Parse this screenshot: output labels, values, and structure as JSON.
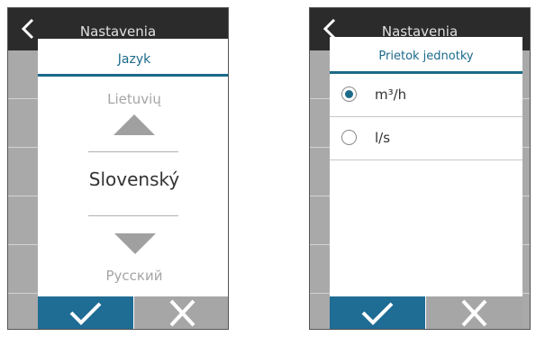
{
  "left_screen": {
    "header_title": "Nastavenia",
    "dialog": {
      "title": "Jazyk",
      "prev_language": "Lietuvių",
      "current_language": "Slovenský",
      "next_language": "Русский",
      "up_icon": "arrow-up-icon",
      "down_icon": "arrow-down-icon",
      "confirm_icon": "checkmark-icon",
      "cancel_icon": "close-icon"
    }
  },
  "right_screen": {
    "header_title": "Nastavenia",
    "dialog": {
      "title": "Prietok jednotky",
      "options": [
        {
          "label": "m³/h",
          "selected": true
        },
        {
          "label": "l/s",
          "selected": false
        }
      ],
      "confirm_icon": "checkmark-icon",
      "cancel_icon": "close-icon"
    }
  },
  "colors": {
    "accent": "#1c6a8a",
    "confirm_button": "#1f6c94",
    "cancel_button": "#a6a6a6",
    "header": "#2b2b2b",
    "background_rows": "#a9a9a9"
  }
}
